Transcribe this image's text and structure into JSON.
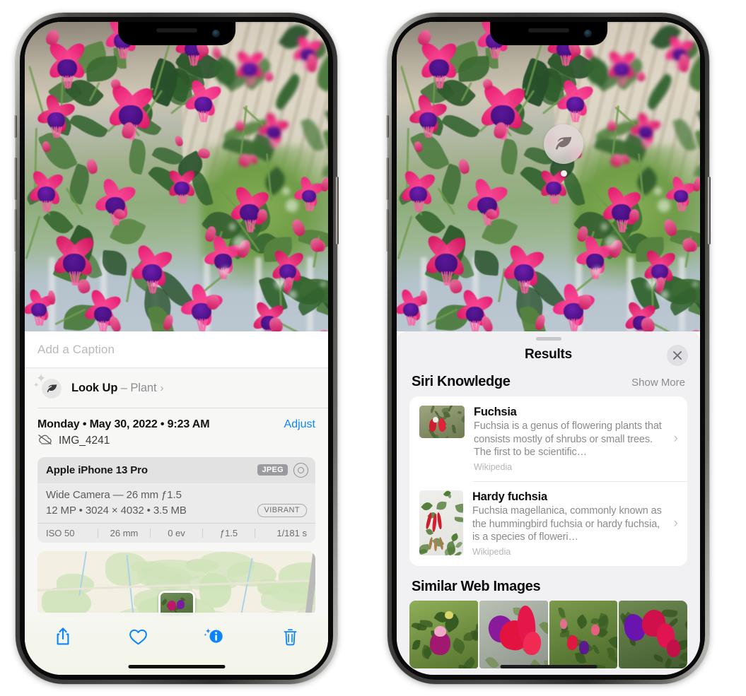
{
  "left_phone": {
    "caption": {
      "placeholder": "Add a Caption"
    },
    "lookup": {
      "label": "Look Up",
      "dash": " – ",
      "subject": "Plant",
      "chevron": "›",
      "icon": "leaf-icon",
      "sparkle": "✦"
    },
    "datetime": "Monday • May 30, 2022 • 9:23 AM",
    "adjust_label": "Adjust",
    "filename": "IMG_4241",
    "cloud_icon": "cloud-slash-icon",
    "exif": {
      "model": "Apple iPhone 13 Pro",
      "format_chip": "JPEG",
      "aperture_icon": "aperture-icon",
      "lens_line": "Wide Camera — 26 mm ƒ1.5",
      "specs_line": "12 MP • 3024 × 4032 • 3.5 MB",
      "style_chip": "VIBRANT",
      "stats": [
        "ISO 50",
        "26 mm",
        "0 ev",
        "ƒ1.5",
        "1/181 s"
      ]
    },
    "toolbar": [
      {
        "name": "share-button",
        "icon": "share-icon"
      },
      {
        "name": "favorite-button",
        "icon": "heart-icon"
      },
      {
        "name": "info-button",
        "icon": "info-sparkle-icon"
      },
      {
        "name": "delete-button",
        "icon": "trash-icon"
      }
    ]
  },
  "right_phone": {
    "badge": {
      "icon": "leaf-icon"
    },
    "panel": {
      "title": "Results",
      "close_icon": "close-icon",
      "sections": [
        {
          "title": "Siri Knowledge",
          "action": "Show More",
          "cards": [
            {
              "title": "Fuchsia",
              "description": "Fuchsia is a genus of flowering plants that consists mostly of shrubs or small trees. The first to be scientific…",
              "source": "Wikipedia",
              "chevron": "›",
              "thumb": "fuchsia-thumbnail"
            },
            {
              "title": "Hardy fuchsia",
              "description": "Fuchsia magellanica, commonly known as the hummingbird fuchsia or hardy fuchsia, is a species of floweri…",
              "source": "Wikipedia",
              "chevron": "›",
              "thumb": "hardy-fuchsia-thumbnail"
            }
          ]
        },
        {
          "title": "Similar Web Images",
          "images": [
            {
              "name": "web-image-1"
            },
            {
              "name": "web-image-2"
            },
            {
              "name": "web-image-3"
            },
            {
              "name": "web-image-4"
            }
          ]
        }
      ]
    }
  },
  "colors": {
    "accent_blue": "#0a84ff",
    "panel_bg": "#f1f1f4",
    "sheet_bg": "#f7f7f5",
    "exif_bg": "#ebebeb",
    "muted_text": "#8a8a8f"
  }
}
